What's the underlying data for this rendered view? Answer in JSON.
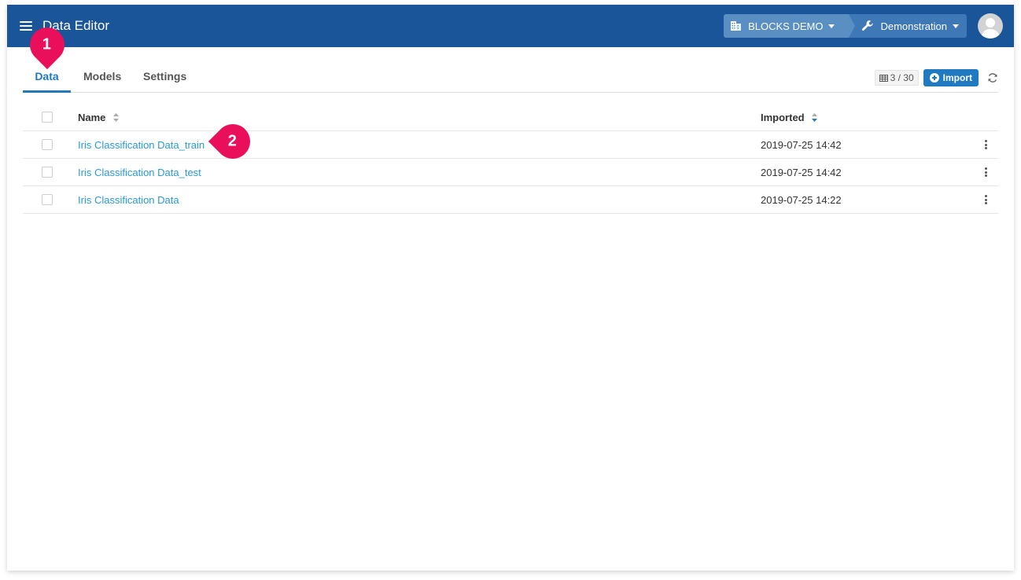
{
  "app": {
    "title": "Data Editor",
    "organization": "BLOCKS DEMO",
    "project": "Demonstration",
    "brand_color": "#1a5499",
    "accent_color": "#1f7ac2",
    "icons": {
      "menu": "hamburger-menu-icon",
      "organization": "building-icon",
      "project": "wrench-icon",
      "user": "avatar-icon"
    }
  },
  "tabs": [
    {
      "label": "Data",
      "active": true
    },
    {
      "label": "Models",
      "active": false
    },
    {
      "label": "Settings",
      "active": false
    }
  ],
  "toolbar": {
    "count_label": "3 / 30",
    "import_label": "Import",
    "icons": {
      "count": "table-icon",
      "import": "plus-circle-icon",
      "refresh": "refresh-icon"
    }
  },
  "table": {
    "columns": {
      "name": "Name",
      "imported": "Imported"
    },
    "sort": {
      "column": "imported",
      "direction": "descending"
    },
    "rows": [
      {
        "name": "Iris Classification Data_train",
        "imported": "2019-07-25 14:42"
      },
      {
        "name": "Iris Classification Data_test",
        "imported": "2019-07-25 14:42"
      },
      {
        "name": "Iris Classification Data",
        "imported": "2019-07-25 14:22"
      }
    ]
  },
  "callouts": [
    {
      "number": "1",
      "target": "Data tab"
    },
    {
      "number": "2",
      "target": "Iris Classification Data_train"
    }
  ],
  "callout_color": "#ea0f5b"
}
